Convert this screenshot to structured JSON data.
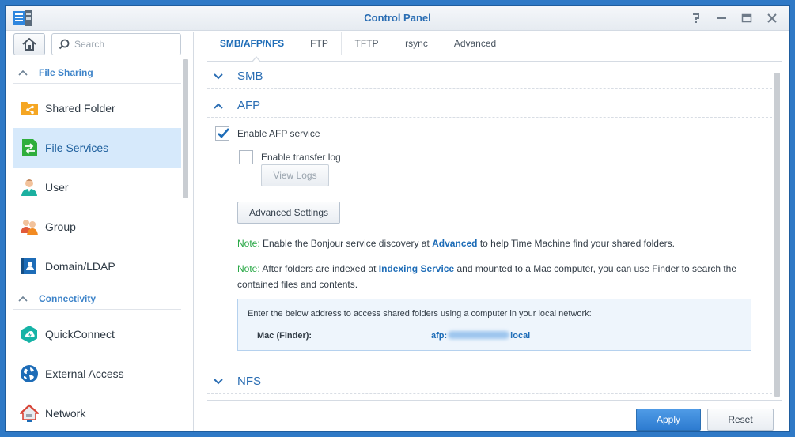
{
  "window": {
    "title": "Control Panel"
  },
  "sidebar": {
    "search_placeholder": "Search",
    "sections": [
      {
        "label": "File Sharing"
      },
      {
        "label": "Connectivity"
      }
    ],
    "items": [
      {
        "label": "Shared Folder",
        "icon": "shared-folder-icon"
      },
      {
        "label": "File Services",
        "icon": "file-services-icon",
        "active": true
      },
      {
        "label": "User",
        "icon": "user-icon"
      },
      {
        "label": "Group",
        "icon": "group-icon"
      },
      {
        "label": "Domain/LDAP",
        "icon": "domain-ldap-icon"
      },
      {
        "label": "QuickConnect",
        "icon": "quickconnect-icon"
      },
      {
        "label": "External Access",
        "icon": "external-access-icon"
      },
      {
        "label": "Network",
        "icon": "network-icon"
      }
    ]
  },
  "tabs": [
    {
      "label": "SMB/AFP/NFS",
      "active": true
    },
    {
      "label": "FTP"
    },
    {
      "label": "TFTP"
    },
    {
      "label": "rsync"
    },
    {
      "label": "Advanced"
    }
  ],
  "sections": {
    "smb": {
      "title": "SMB"
    },
    "afp": {
      "title": "AFP",
      "enable_label": "Enable AFP service",
      "enable_checked": true,
      "transfer_log_label": "Enable transfer log",
      "transfer_log_checked": false,
      "view_logs_label": "View Logs",
      "advanced_settings_label": "Advanced Settings",
      "note1": {
        "prefix": "Note:",
        "before": " Enable the Bonjour service discovery at ",
        "link": "Advanced",
        "after": " to help Time Machine find your shared folders."
      },
      "note2": {
        "prefix": "Note:",
        "before": " After folders are indexed at ",
        "link": "Indexing Service",
        "after": " and mounted to a Mac computer, you can use Finder to search the contained files and contents."
      },
      "info": {
        "intro": "Enter the below address to access shared folders using a computer in your local network:",
        "key": "Mac (Finder):",
        "value_prefix": "afp:",
        "value_suffix": "local"
      }
    },
    "nfs": {
      "title": "NFS"
    }
  },
  "footer": {
    "apply_label": "Apply",
    "reset_label": "Reset"
  },
  "colors": {
    "accent": "#1d6cb7",
    "active_item_bg": "#d6e9fb",
    "note": "#28a745",
    "apply": "#2d7bd0"
  }
}
